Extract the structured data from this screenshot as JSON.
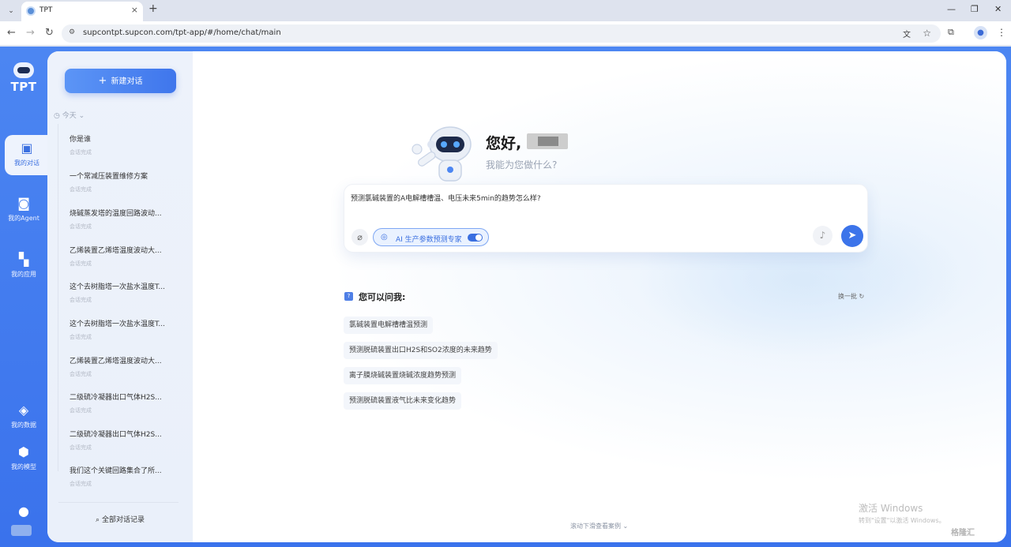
{
  "browser": {
    "tab_title": "TPT",
    "url": "supcontpt.supcon.com/tpt-app/#/home/chat/main"
  },
  "rail": {
    "logo_text": "TPT",
    "items": [
      {
        "label": "我的对话",
        "icon": "chat-bubble-icon",
        "active": true
      },
      {
        "label": "我的Agent",
        "icon": "robot-icon",
        "active": false
      },
      {
        "label": "我的应用",
        "icon": "apps-grid-icon",
        "active": false
      },
      {
        "label": "我的数据",
        "icon": "layers-icon",
        "active": false
      },
      {
        "label": "我的模型",
        "icon": "cube-icon",
        "active": false
      }
    ]
  },
  "sidebar": {
    "new_chat_label": "新建对话",
    "section_label": "今天",
    "conversations": [
      {
        "title": "你是谁",
        "status": "会话完成"
      },
      {
        "title": "一个常减压装置维修方案",
        "status": "会话完成"
      },
      {
        "title": "烧碱蒸发塔的温度回路波动...",
        "status": "会话完成"
      },
      {
        "title": "乙烯装置乙烯塔温度波动大...",
        "status": "会话完成"
      },
      {
        "title": "这个去树脂塔一次盐水温度T...",
        "status": "会话完成"
      },
      {
        "title": "这个去树脂塔一次盐水温度T...",
        "status": "会话完成"
      },
      {
        "title": "乙烯装置乙烯塔温度波动大...",
        "status": "会话完成"
      },
      {
        "title": "二级硫冷凝器出口气体H2S...",
        "status": "会话完成"
      },
      {
        "title": "二级硫冷凝器出口气体H2S...",
        "status": "会话完成"
      },
      {
        "title": "我们这个关键回路集合了所...",
        "status": "会话完成"
      }
    ],
    "all_history_label": "全部对话记录"
  },
  "main": {
    "greeting": "您好,",
    "subgreeting": "我能为您做什么?",
    "input_text": "预测氯碱装置的A电解槽槽温、电压未来5min的趋势怎么样?",
    "agent_chip_label": "AI 生产参数预测专家",
    "ask_title": "您可以问我:",
    "refresh_label": "换一批",
    "suggestions": [
      "氯碱装置电解槽槽温预测",
      "预测脱硫装置出口H2S和SO2浓度的未来趋势",
      "离子膜烧碱装置烧碱浓度趋势预测",
      "预测脱硫装置液气比未来变化趋势"
    ],
    "scroll_hint": "滚动下滑查看案例"
  },
  "overlay": {
    "activate_title": "激活 Windows",
    "activate_sub": "转到\"设置\"以激活 Windows。",
    "source_mark": "格隆汇"
  }
}
